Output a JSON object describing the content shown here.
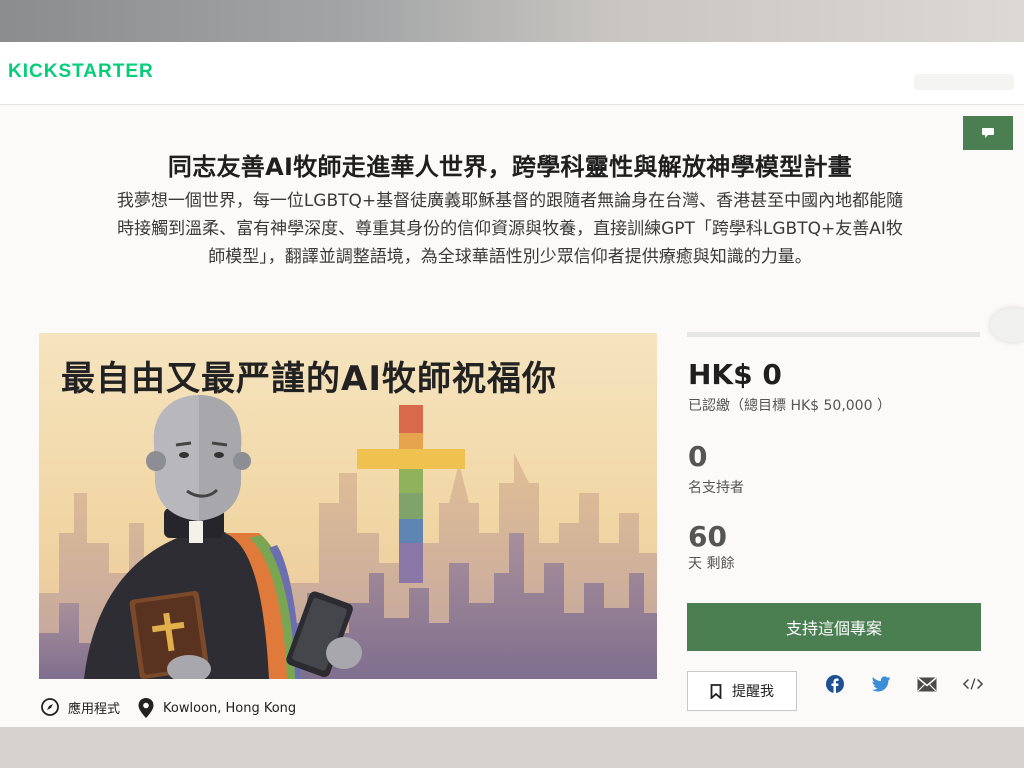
{
  "header": {
    "logo_text": "KICKSTARTER"
  },
  "project": {
    "title": "同志友善AI牧師走進華人世界，跨學科靈性與解放神學模型計畫",
    "blurb": "我夢想一個世界，每一位LGBTQ+基督徒廣義耶穌基督的跟隨者無論身在台灣、香港甚至中國內地都能隨時接觸到溫柔、富有神學深度、尊重其身份的信仰資源與牧養，直接訓練GPT「跨學科LGBTQ+友善AI牧師模型」，翻譯並調整語境，為全球華語性別少眾信仰者提供療癒與知識的力量。",
    "hero_text": "最自由又最严謹的AI牧師祝福你",
    "category": "應用程式",
    "location": "Kowloon, Hong Kong"
  },
  "stats": {
    "progress_fraction": 0,
    "pledged": "HK$ 0",
    "goal_label": "已認繳（總目標 HK$ 50,000 ）",
    "backers_count": "0",
    "backers_label": "名支持者",
    "days_count": "60",
    "days_label": "天 剩餘"
  },
  "actions": {
    "back_label": "支持這個專案",
    "remind_label": "提醒我"
  },
  "share_icons": [
    "facebook-icon",
    "twitter-icon",
    "email-icon",
    "embed-icon"
  ],
  "colors": {
    "brand_green": "#4b7f52",
    "logo_green": "#05ce78"
  }
}
